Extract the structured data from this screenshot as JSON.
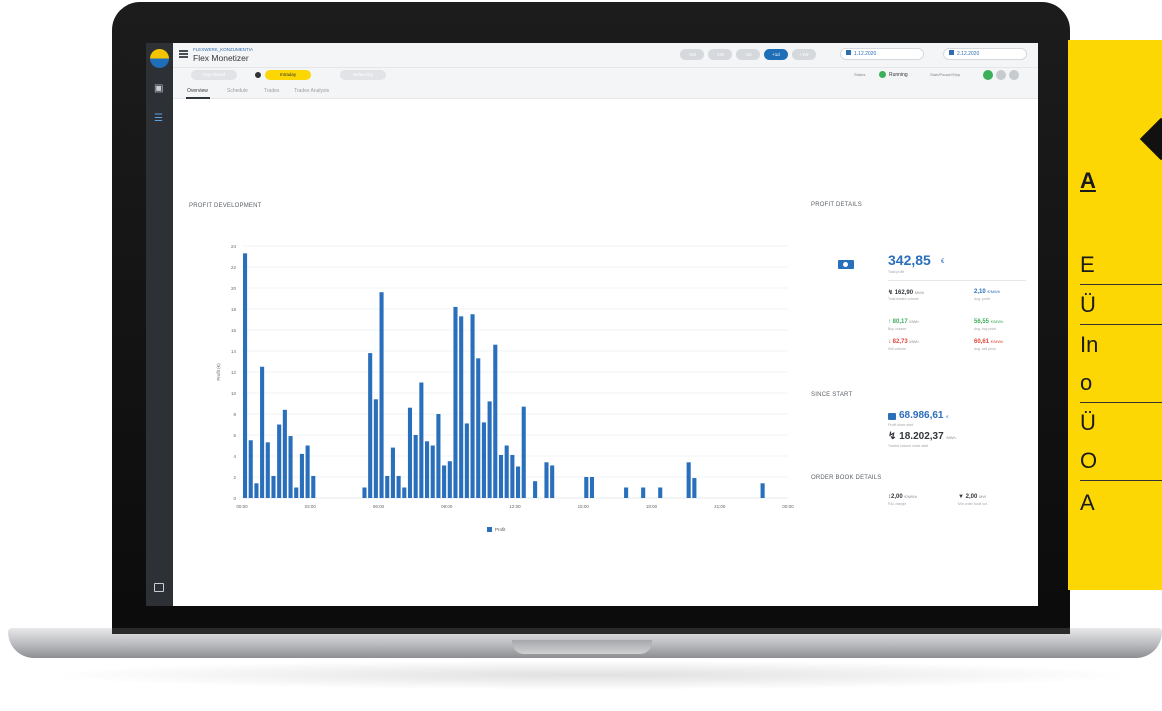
{
  "app": {
    "subtitle": "FLEXWERK_KONZUMENTIA",
    "title": "Flex Monetizer"
  },
  "topbar": {
    "ranges": [
      "-1M",
      "-1W",
      "-1D",
      "+1d",
      "+1W"
    ],
    "active_range": "+1d",
    "date_from": "1.12.2020",
    "date_to": "2.12.2020"
  },
  "subbar": {
    "day_ahead": "Day Ahead",
    "intraday": "Intraday",
    "balancing": "Balancing",
    "status_label": "Status",
    "status_value": "Running",
    "controls_label": "Start/Pause/Stop"
  },
  "tabs": [
    "Overview",
    "Schedule",
    "Trades",
    "Trades Analysis"
  ],
  "profit_development": {
    "title": "PROFIT DEVELOPMENT",
    "legend": "Profit"
  },
  "chart_data": {
    "type": "bar",
    "title": "PROFIT DEVELOPMENT",
    "xlabel": "",
    "ylabel": "Profit (€)",
    "ylim": [
      0,
      24
    ],
    "yticks": [
      "0",
      "2",
      "4",
      "6",
      "8",
      "10",
      "12",
      "14",
      "16",
      "18",
      "20",
      "22",
      "24"
    ],
    "xticks": [
      "00:00",
      "03:00",
      "06:00",
      "09:00",
      "12:00",
      "15:00",
      "18:00",
      "21:00",
      "00:00"
    ],
    "x_unit": "hours",
    "series": [
      {
        "name": "Profit",
        "color": "#2a6fbb",
        "x": [
          0,
          0.25,
          0.5,
          0.75,
          1,
          1.25,
          1.5,
          1.75,
          2,
          2.25,
          2.5,
          2.75,
          3,
          3.25,
          5.25,
          5.5,
          5.75,
          6,
          6.25,
          6.5,
          6.75,
          7,
          7.25,
          7.5,
          7.75,
          8,
          8.25,
          8.5,
          8.75,
          9,
          9.25,
          9.5,
          9.75,
          10,
          10.25,
          10.5,
          10.75,
          11,
          11.25,
          11.5,
          11.75,
          12,
          12.25,
          12.75,
          13.25,
          13.5,
          15,
          15.25,
          16.75,
          17.5,
          18.25,
          19.5,
          19.75,
          22.75
        ],
        "values": [
          23.3,
          5.5,
          1.4,
          12.5,
          5.3,
          2.1,
          7.0,
          8.4,
          5.9,
          1.0,
          4.2,
          5.0,
          2.1,
          0,
          1.0,
          13.8,
          9.4,
          19.6,
          2.1,
          4.8,
          2.1,
          1.0,
          8.6,
          6.0,
          11.0,
          5.4,
          5.0,
          8.0,
          3.1,
          3.5,
          18.2,
          17.3,
          7.1,
          17.5,
          13.3,
          7.2,
          9.2,
          14.6,
          4.1,
          5.0,
          4.1,
          3.0,
          8.7,
          1.6,
          3.4,
          3.1,
          2.0,
          2.0,
          1.0,
          1.0,
          1.0,
          3.4,
          1.9,
          1.4
        ]
      }
    ]
  },
  "profit_details": {
    "title": "PROFIT DETAILS",
    "total_profit": "342,85",
    "total_profit_unit": "€",
    "total_profit_label": "Total profit",
    "traded_volume": "162,90",
    "traded_volume_unit": "MWh",
    "traded_volume_label": "Total traded volume",
    "avg_profit": "2,10",
    "avg_profit_unit": "€/MWh",
    "avg_profit_label": "Avg. profit",
    "buy_volume": "80,17",
    "buy_volume_unit": "MWh",
    "buy_volume_label": "Buy volume",
    "avg_buy_price": "56,55",
    "avg_buy_price_unit": "€/MWh",
    "avg_buy_price_label": "Avg. buy price",
    "sell_volume": "82,73",
    "sell_volume_unit": "MWh",
    "sell_volume_label": "Sell volume",
    "avg_sell_price": "60,61",
    "avg_sell_price_unit": "€/MWh",
    "avg_sell_price_label": "Avg. sell price"
  },
  "since_start": {
    "title": "SINCE START",
    "profit": "68.986,61",
    "profit_unit": "€",
    "profit_label": "Profit since start",
    "volume": "18.202,37",
    "volume_unit": "MWh",
    "volume_label": "Traded volume since start"
  },
  "order_book": {
    "title": "ORDER BOOK DETAILS",
    "pm_margin": "2,00",
    "pm_margin_unit": "€/MWh",
    "pm_margin_label": "P&L margin",
    "min_order": "2,00",
    "min_order_unit": "MW",
    "min_order_label": "Min order book vol."
  },
  "yellow_panel": {
    "items": [
      "A",
      "E",
      "Ü",
      "In",
      "o",
      "Ü",
      "O",
      "A"
    ]
  }
}
